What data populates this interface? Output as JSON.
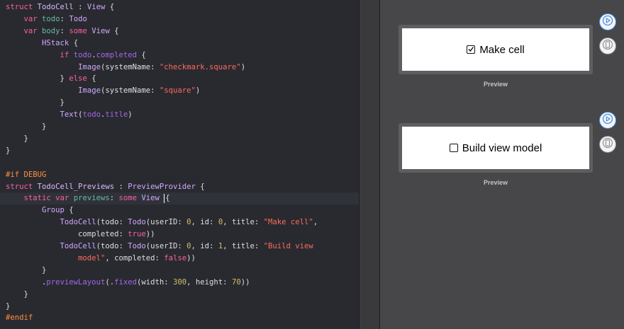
{
  "editor": {
    "lines": [
      [
        {
          "c": "kw",
          "t": "struct "
        },
        {
          "c": "typ",
          "t": "TodoCell"
        },
        {
          "c": "plain",
          "t": " : "
        },
        {
          "c": "type",
          "t": "View"
        },
        {
          "c": "plain",
          "t": " {"
        }
      ],
      [
        {
          "c": "plain",
          "t": "    "
        },
        {
          "c": "kw",
          "t": "var "
        },
        {
          "c": "fn",
          "t": "todo"
        },
        {
          "c": "plain",
          "t": ": "
        },
        {
          "c": "type",
          "t": "Todo"
        }
      ],
      [
        {
          "c": "plain",
          "t": "    "
        },
        {
          "c": "kw",
          "t": "var "
        },
        {
          "c": "fn",
          "t": "body"
        },
        {
          "c": "plain",
          "t": ": "
        },
        {
          "c": "kw",
          "t": "some "
        },
        {
          "c": "type",
          "t": "View"
        },
        {
          "c": "plain",
          "t": " {"
        }
      ],
      [
        {
          "c": "plain",
          "t": "        "
        },
        {
          "c": "type",
          "t": "HStack"
        },
        {
          "c": "plain",
          "t": " {"
        }
      ],
      [
        {
          "c": "plain",
          "t": "            "
        },
        {
          "c": "kw",
          "t": "if "
        },
        {
          "c": "prop",
          "t": "todo"
        },
        {
          "c": "plain",
          "t": "."
        },
        {
          "c": "prop",
          "t": "completed"
        },
        {
          "c": "plain",
          "t": " {"
        }
      ],
      [
        {
          "c": "plain",
          "t": "                "
        },
        {
          "c": "type",
          "t": "Image"
        },
        {
          "c": "plain",
          "t": "(systemName: "
        },
        {
          "c": "str",
          "t": "\"checkmark.square\""
        },
        {
          "c": "plain",
          "t": ")"
        }
      ],
      [
        {
          "c": "plain",
          "t": "            } "
        },
        {
          "c": "kw",
          "t": "else"
        },
        {
          "c": "plain",
          "t": " {"
        }
      ],
      [
        {
          "c": "plain",
          "t": "                "
        },
        {
          "c": "type",
          "t": "Image"
        },
        {
          "c": "plain",
          "t": "(systemName: "
        },
        {
          "c": "str",
          "t": "\"square\""
        },
        {
          "c": "plain",
          "t": ")"
        }
      ],
      [
        {
          "c": "plain",
          "t": "            }"
        }
      ],
      [
        {
          "c": "plain",
          "t": "            "
        },
        {
          "c": "type",
          "t": "Text"
        },
        {
          "c": "plain",
          "t": "("
        },
        {
          "c": "prop",
          "t": "todo"
        },
        {
          "c": "plain",
          "t": "."
        },
        {
          "c": "prop",
          "t": "title"
        },
        {
          "c": "plain",
          "t": ")"
        }
      ],
      [
        {
          "c": "plain",
          "t": "        }"
        }
      ],
      [
        {
          "c": "plain",
          "t": "    }"
        }
      ],
      [
        {
          "c": "plain",
          "t": "}"
        }
      ],
      [],
      [
        {
          "c": "pre",
          "t": "#if DEBUG"
        }
      ],
      [
        {
          "c": "kw",
          "t": "struct "
        },
        {
          "c": "typ",
          "t": "TodoCell_Previews"
        },
        {
          "c": "plain",
          "t": " : "
        },
        {
          "c": "type",
          "t": "PreviewProvider"
        },
        {
          "c": "plain",
          "t": " {"
        }
      ],
      [
        {
          "c": "plain",
          "t": "    "
        },
        {
          "c": "kw",
          "t": "static var "
        },
        {
          "c": "fn",
          "t": "previews"
        },
        {
          "c": "plain",
          "t": ": "
        },
        {
          "c": "kw",
          "t": "some "
        },
        {
          "c": "type",
          "t": "View"
        },
        {
          "c": "plain",
          "t": " "
        },
        {
          "c": "caret",
          "t": ""
        },
        {
          "c": "plain",
          "t": "{"
        }
      ],
      [
        {
          "c": "plain",
          "t": "        "
        },
        {
          "c": "type",
          "t": "Group"
        },
        {
          "c": "plain",
          "t": " {"
        }
      ],
      [
        {
          "c": "plain",
          "t": "            "
        },
        {
          "c": "type",
          "t": "TodoCell"
        },
        {
          "c": "plain",
          "t": "(todo: "
        },
        {
          "c": "type",
          "t": "Todo"
        },
        {
          "c": "plain",
          "t": "(userID: "
        },
        {
          "c": "num",
          "t": "0"
        },
        {
          "c": "plain",
          "t": ", id: "
        },
        {
          "c": "num",
          "t": "0"
        },
        {
          "c": "plain",
          "t": ", title: "
        },
        {
          "c": "str",
          "t": "\"Make cell\""
        },
        {
          "c": "plain",
          "t": ","
        }
      ],
      [
        {
          "c": "plain",
          "t": "                completed: "
        },
        {
          "c": "kw",
          "t": "true"
        },
        {
          "c": "plain",
          "t": "))"
        }
      ],
      [
        {
          "c": "plain",
          "t": "            "
        },
        {
          "c": "type",
          "t": "TodoCell"
        },
        {
          "c": "plain",
          "t": "(todo: "
        },
        {
          "c": "type",
          "t": "Todo"
        },
        {
          "c": "plain",
          "t": "(userID: "
        },
        {
          "c": "num",
          "t": "0"
        },
        {
          "c": "plain",
          "t": ", id: "
        },
        {
          "c": "num",
          "t": "1"
        },
        {
          "c": "plain",
          "t": ", title: "
        },
        {
          "c": "str",
          "t": "\"Build view"
        }
      ],
      [
        {
          "c": "str",
          "t": "                model\""
        },
        {
          "c": "plain",
          "t": ", completed: "
        },
        {
          "c": "kw",
          "t": "false"
        },
        {
          "c": "plain",
          "t": "))"
        }
      ],
      [
        {
          "c": "plain",
          "t": "        }"
        }
      ],
      [
        {
          "c": "plain",
          "t": "        ."
        },
        {
          "c": "prop",
          "t": "previewLayout"
        },
        {
          "c": "plain",
          "t": "(."
        },
        {
          "c": "prop",
          "t": "fixed"
        },
        {
          "c": "plain",
          "t": "(width: "
        },
        {
          "c": "num",
          "t": "300"
        },
        {
          "c": "plain",
          "t": ", height: "
        },
        {
          "c": "num",
          "t": "70"
        },
        {
          "c": "plain",
          "t": "))"
        }
      ],
      [
        {
          "c": "plain",
          "t": "    }"
        }
      ],
      [
        {
          "c": "plain",
          "t": "}"
        }
      ],
      [
        {
          "c": "pre",
          "t": "#endif"
        }
      ]
    ],
    "current_line": 16
  },
  "previews": [
    {
      "title": "Make cell",
      "checked": true,
      "label": "Preview"
    },
    {
      "title": "Build view model",
      "checked": false,
      "label": "Preview"
    }
  ],
  "icons": {
    "live": "play-circle-icon",
    "device": "device-icon",
    "checkbox_checked": "checkmark-square-icon",
    "checkbox_empty": "square-icon"
  },
  "colors": {
    "keyword": "#fc5fa3",
    "type": "#d0a8ff",
    "string": "#fc6a5d",
    "number": "#d0bf69",
    "preprocessor": "#fd8f3f",
    "accent": "#4a90e2"
  }
}
